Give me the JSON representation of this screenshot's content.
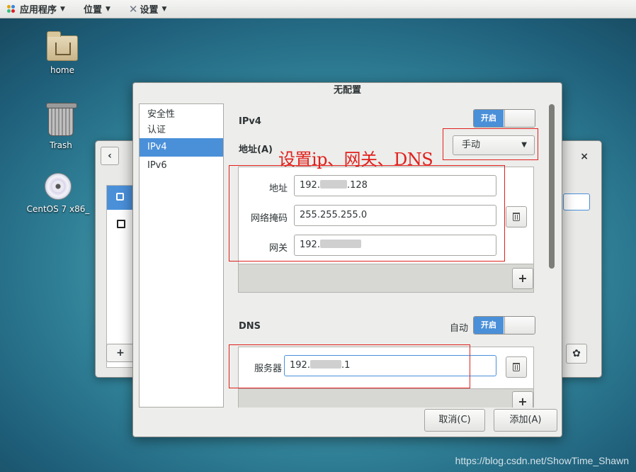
{
  "topbar": {
    "apps_label": "应用程序",
    "places_label": "位置",
    "settings_label": "设置"
  },
  "desktop": {
    "icons": [
      {
        "label": "home",
        "icon": "home-folder-icon"
      },
      {
        "label": "Trash",
        "icon": "trash-icon"
      },
      {
        "label": "CentOS 7 x86_",
        "icon": "disc-icon"
      }
    ]
  },
  "background_window": {
    "back_glyph": "‹",
    "close_glyph": "×",
    "add_glyph": "+",
    "gear_glyph": "✿"
  },
  "dialog": {
    "title": "无配置",
    "sidebar": [
      "安全性",
      "认证",
      "IPv4",
      "IPv6"
    ],
    "selected_sidebar": "IPv4",
    "ipv4": {
      "section_label": "IPv4",
      "switch_on": "开启",
      "addresses_label": "地址(A)",
      "method": "手动",
      "address_label": "地址",
      "address_value_prefix": "192.",
      "address_value_suffix": ".128",
      "netmask_label": "网络掩码",
      "netmask_value": "255.255.255.0",
      "gateway_label": "网关",
      "gateway_value_prefix": "192.",
      "add_glyph": "+"
    },
    "dns": {
      "section_label": "DNS",
      "auto_label": "自动",
      "switch_on": "开启",
      "server_label": "服务器",
      "server_value_prefix": "192.",
      "server_value_suffix": ".1",
      "add_glyph": "+"
    },
    "buttons": {
      "cancel": "取消(C)",
      "add": "添加(A)"
    }
  },
  "annotation": {
    "text": "设置ip、网关、DNS",
    "color": "#e0211d"
  },
  "watermark": "https://blog.csdn.net/ShowTime_Shawn",
  "colors": {
    "accent": "#4a90d9",
    "annotation": "#e0211d"
  }
}
